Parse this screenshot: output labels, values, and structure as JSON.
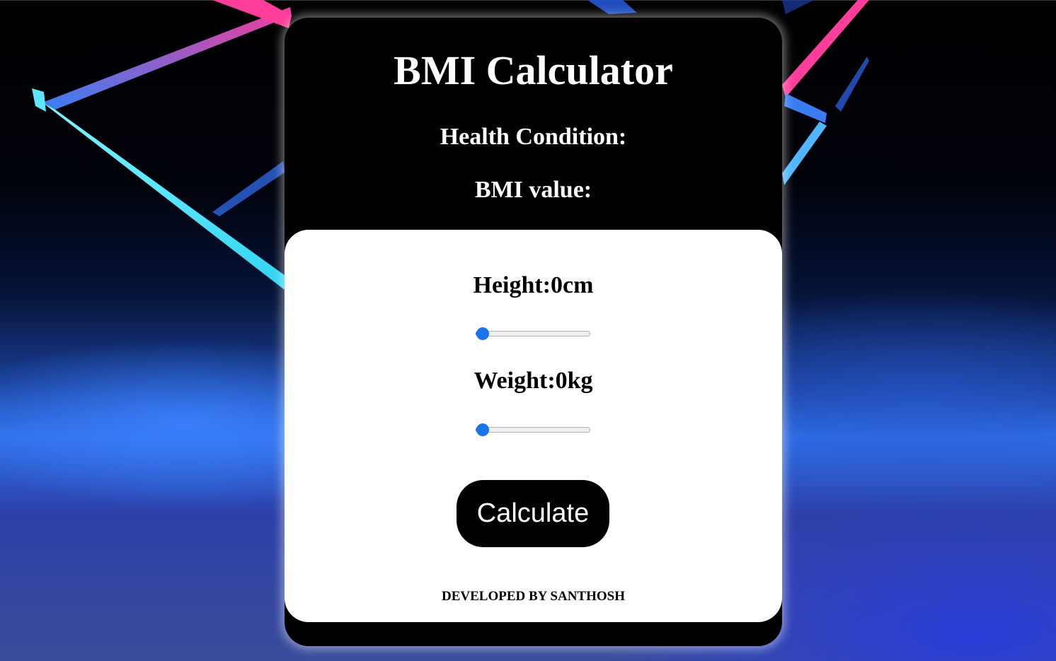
{
  "app": {
    "title": "BMI Calculator"
  },
  "results": {
    "health_label": "Health Condition:",
    "bmi_label": "BMI value:"
  },
  "height": {
    "label": "Height:0cm",
    "value": 0,
    "min": 0,
    "max": 100
  },
  "weight": {
    "label": "Weight:0kg",
    "value": 0,
    "min": 0,
    "max": 100
  },
  "actions": {
    "calculate_label": "Calculate"
  },
  "footer": {
    "credit": "DEVELOPED BY SANTHOSH"
  },
  "colors": {
    "slider_accent": "#1a73e8",
    "card_background": "#000000",
    "panel_background": "#ffffff"
  }
}
